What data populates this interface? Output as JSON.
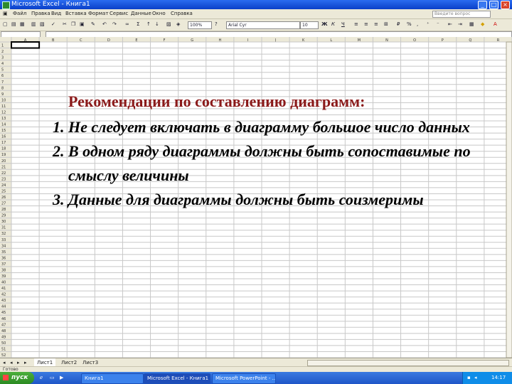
{
  "window": {
    "title": "Microsoft Excel - Книга1"
  },
  "menu": {
    "items": [
      "Файл",
      "Правка",
      "Вид",
      "Вставка",
      "Формат",
      "Сервис",
      "Данные",
      "Окно",
      "Справка"
    ],
    "help_placeholder": "Введите вопрос"
  },
  "toolbar": {
    "font_size": "100%",
    "font_name": "Arial Cyr",
    "font_pt": "10"
  },
  "grid": {
    "columns": [
      "A",
      "B",
      "C",
      "D",
      "E",
      "F",
      "G",
      "H",
      "I",
      "J",
      "K",
      "L",
      "M",
      "N",
      "O",
      "P",
      "Q",
      "R"
    ],
    "rows": 52
  },
  "slide": {
    "heading": "Рекомендации по составлению диаграмм:",
    "items": [
      "Не следует включать в диаграмму большое число данных",
      "В одном ряду диаграммы должны быть сопоставимые по смыслу величины",
      "Данные для диаграммы должны быть соизмеримы"
    ]
  },
  "sheets": {
    "tabs": [
      "Лист1",
      "Лист2",
      "Лист3"
    ],
    "active": "Лист1"
  },
  "status": {
    "text": "Готово"
  },
  "taskbar": {
    "start_label": "пуск",
    "items": [
      "Книга1",
      "Microsoft Excel - Книга1",
      "Microsoft PowerPoint - ..."
    ],
    "clock": "14:17"
  },
  "colors": {
    "title_bar": "#0a3fc8",
    "heading": "#8b1a1a",
    "taskbar": "#1f56c8",
    "start": "#2b8a22"
  }
}
